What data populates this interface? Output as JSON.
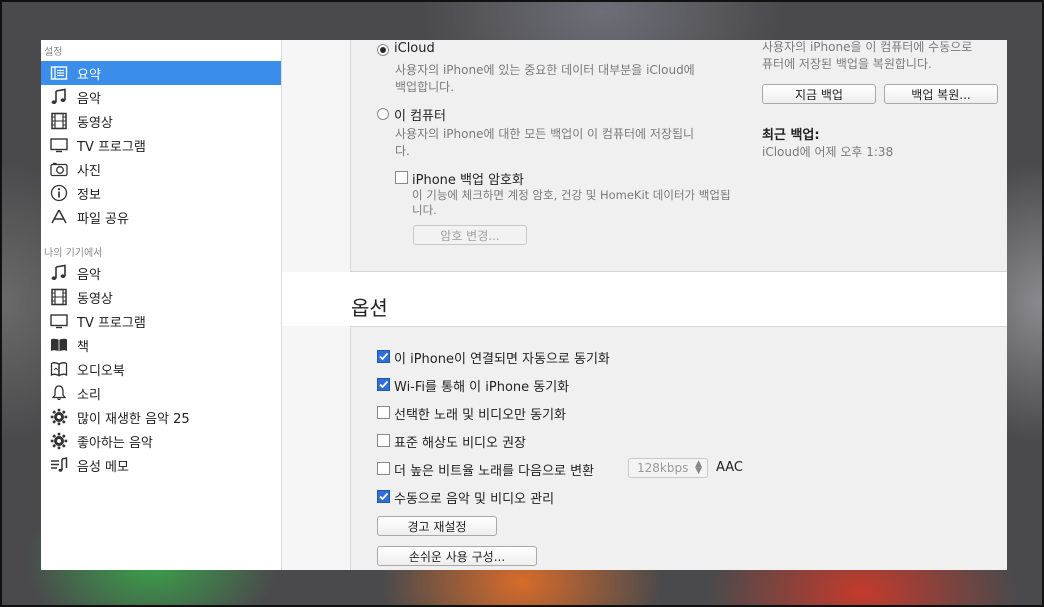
{
  "sidebar": {
    "section_settings": "설정",
    "settings_items": [
      {
        "label": "요약",
        "icon": "summary-icon",
        "active": true
      },
      {
        "label": "음악",
        "icon": "music-note-icon"
      },
      {
        "label": "동영상",
        "icon": "film-icon"
      },
      {
        "label": "TV 프로그램",
        "icon": "tv-icon"
      },
      {
        "label": "사진",
        "icon": "camera-icon"
      },
      {
        "label": "정보",
        "icon": "info-icon"
      },
      {
        "label": "파일 공유",
        "icon": "apps-icon"
      }
    ],
    "section_device": "나의 기기에서",
    "device_items": [
      {
        "label": "음악",
        "icon": "music-note-icon"
      },
      {
        "label": "동영상",
        "icon": "film-icon"
      },
      {
        "label": "TV 프로그램",
        "icon": "tv-icon"
      },
      {
        "label": "책",
        "icon": "book-icon"
      },
      {
        "label": "오디오북",
        "icon": "audiobook-icon"
      },
      {
        "label": "소리",
        "icon": "bell-icon"
      },
      {
        "label": "많이 재생한 음악 25",
        "icon": "gear-icon"
      },
      {
        "label": "좋아하는 음악",
        "icon": "gear-icon"
      },
      {
        "label": "음성 메모",
        "icon": "voice-memo-icon"
      }
    ]
  },
  "backup": {
    "icloud_label": "iCloud",
    "icloud_desc_1": "사용자의 iPhone에 있는 중요한 데이터 대부분을 iCloud에",
    "icloud_desc_2": "백업합니다.",
    "computer_label": "이 컴퓨터",
    "computer_desc_1": "사용자의 iPhone에 대한 모든 백업이 이 컴퓨터에 저장됩니",
    "computer_desc_2": "다.",
    "encrypt_label": "iPhone 백업 암호화",
    "encrypt_desc_1": "이 기능에 체크하면 계정 암호, 건강 및 HomeKit 데이터가 백업됩",
    "encrypt_desc_2": "니다.",
    "change_password_button": "암호 변경...",
    "right_desc_1": "사용자의 iPhone을 이 컴퓨터에 수동으로",
    "right_desc_2": "퓨터에 저장된 백업을 복원합니다.",
    "backup_now_button": "지금 백업",
    "restore_backup_button": "백업 복원...",
    "latest_backup_title": "최근 백업:",
    "latest_backup_value": "iCloud에 어제 오후 1:38"
  },
  "options": {
    "title": "옵션",
    "items": [
      {
        "label": "이 iPhone이 연결되면 자동으로 동기화",
        "checked": true
      },
      {
        "label": "Wi-Fi를 통해 이 iPhone 동기화",
        "checked": true
      },
      {
        "label": "선택한 노래 및 비디오만 동기화",
        "checked": false
      },
      {
        "label": "표준 해상도 비디오 권장",
        "checked": false
      },
      {
        "label": "더 높은 비트율 노래를 다음으로 변환",
        "checked": false
      },
      {
        "label": "수동으로 음악 및 비디오 관리",
        "checked": true
      }
    ],
    "bitrate_value": "128kbps",
    "bitrate_format": "AAC",
    "reset_warnings_button": "경고 재설정",
    "accessibility_button": "손쉬운 사용 구성..."
  }
}
